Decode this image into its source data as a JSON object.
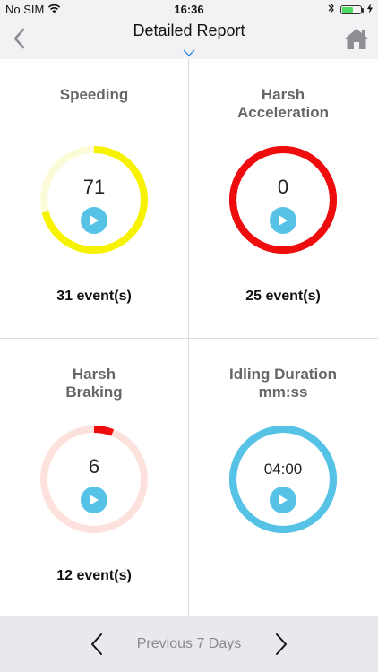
{
  "status_bar": {
    "carrier": "No SIM",
    "time": "16:36"
  },
  "nav": {
    "title": "Detailed Report",
    "back_icon": "chevron-left-icon",
    "home_icon": "home-icon"
  },
  "tiles": [
    {
      "title_line1": "Speeding",
      "title_line2": "",
      "value": "71",
      "events": "31 event(s)",
      "ring_color": "#f7f200",
      "track_color": "#fcfbd9",
      "fraction": 0.71
    },
    {
      "title_line1": "Harsh",
      "title_line2": "Acceleration",
      "value": "0",
      "events": "25 event(s)",
      "ring_color": "#ee0c0c",
      "track_color": "#ee0c0c",
      "fraction": 1.0
    },
    {
      "title_line1": "Harsh",
      "title_line2": "Braking",
      "value": "6",
      "events": "12 event(s)",
      "ring_color": "#ee0c0c",
      "track_color": "#fde1dc",
      "fraction": 0.06
    },
    {
      "title_line1": "Idling Duration",
      "title_line2": "mm:ss",
      "value": "04:00",
      "events": "",
      "ring_color": "#55c2e6",
      "track_color": "#55c2e6",
      "fraction": 1.0
    }
  ],
  "footer": {
    "label": "Previous 7 Days"
  }
}
